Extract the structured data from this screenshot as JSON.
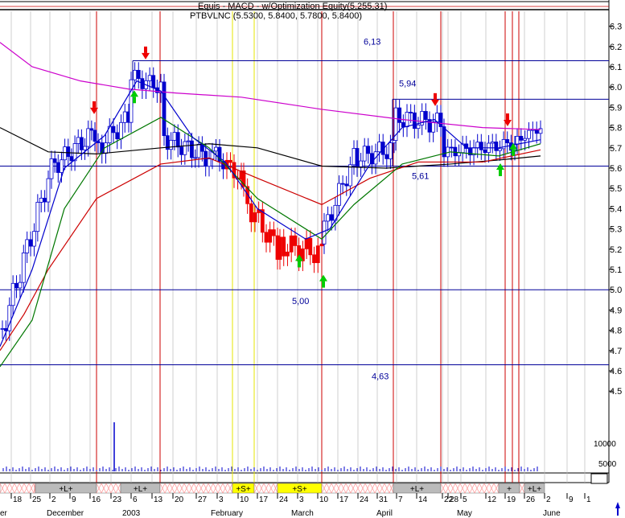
{
  "header": {
    "line1": "Equis - MACD - w/Optimization Equity(5.255,31)",
    "line2": "PTBVLNC (5.5300, 5.8400, 5.7800, 5.8400)"
  },
  "chart_data": {
    "type": "candlestick",
    "title": "",
    "ylim": [
      4.35,
      6.35
    ],
    "y_ticks": [
      "6.3",
      "6.2",
      "6.1",
      "6.0",
      "5.9",
      "5.8",
      "5.7",
      "5.6",
      "5.5",
      "5.4",
      "5.3",
      "5.2",
      "5.1",
      "5.0",
      "4.9",
      "4.8",
      "4.7",
      "4.6",
      "4.5"
    ],
    "volume_ticks": [
      "10000",
      "5000"
    ],
    "x_ticks": [
      "18",
      "25",
      "2",
      "9",
      "16",
      "23",
      "6",
      "13",
      "20",
      "27",
      "3",
      "10",
      "17",
      "24",
      "3",
      "10",
      "17",
      "24",
      "31",
      "7",
      "14",
      "22",
      "28",
      "5",
      "12",
      "19",
      "26",
      "2",
      "9",
      "1"
    ],
    "month_labels": [
      "er",
      "December",
      "2003",
      "February",
      "March",
      "April",
      "May",
      "June"
    ],
    "price_levels": [
      {
        "value": 6.13,
        "label": "6,13"
      },
      {
        "value": 5.94,
        "label": "5,94"
      },
      {
        "value": 5.61,
        "label": "5,61"
      },
      {
        "value": 5.0,
        "label": "5,00"
      },
      {
        "value": 4.63,
        "label": "4,63"
      }
    ],
    "signal_bar": [
      {
        "label": "",
        "type": "none"
      },
      {
        "label": "+L+",
        "type": "long"
      },
      {
        "label": "",
        "type": "none"
      },
      {
        "label": "+L+",
        "type": "long"
      },
      {
        "label": "",
        "type": "none"
      },
      {
        "label": "+S+",
        "type": "short"
      },
      {
        "label": "",
        "type": "none"
      },
      {
        "label": "+S+",
        "type": "short"
      },
      {
        "label": "",
        "type": "none"
      },
      {
        "label": "+L+",
        "type": "long"
      },
      {
        "label": "",
        "type": "none"
      },
      {
        "label": "+",
        "type": "long"
      },
      {
        "label": "",
        "type": "none"
      },
      {
        "label": "+L+",
        "type": "long"
      }
    ],
    "colors": {
      "up": "#0000cc",
      "down": "#ee0000",
      "ma_fast": "#0000cc",
      "ma_mid": "#007700",
      "ma_slow": "#cc0000",
      "ma_long": "#cc00cc",
      "ma_black": "#000000",
      "signal_long": "#bbbbbb",
      "signal_short": "#ffff00",
      "signal_none": "#ff9999",
      "vline": "#cc0000",
      "vline_yellow": "#e6e600",
      "level": "#000099",
      "arrow_down": "#ee0000",
      "arrow_up": "#00cc00"
    }
  }
}
